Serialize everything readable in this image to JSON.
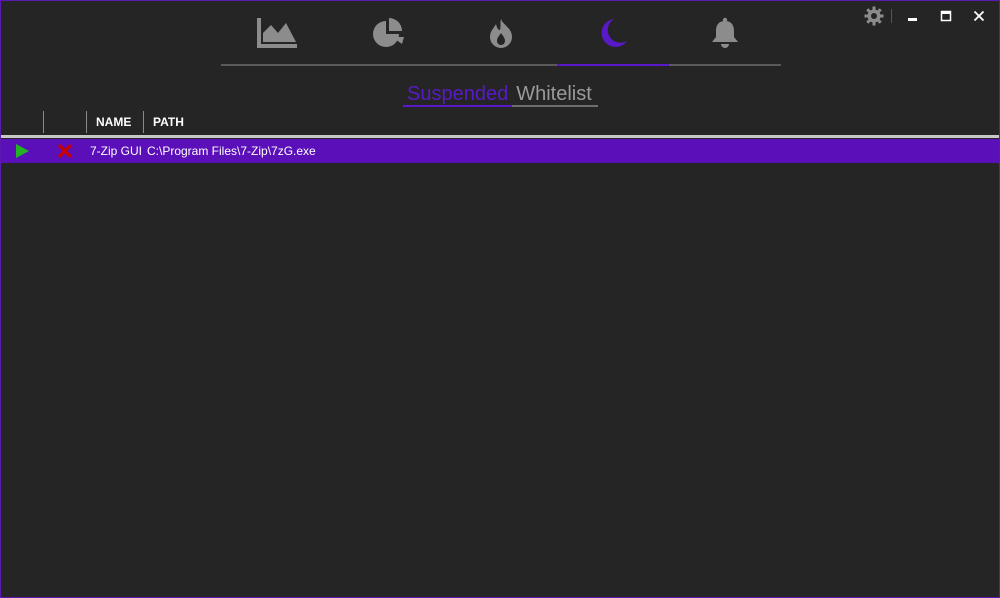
{
  "window": {
    "settings_icon": "gear-icon",
    "minimize_icon": "minimize-icon",
    "maximize_icon": "maximize-icon",
    "close_icon": "close-icon"
  },
  "nav": {
    "items": [
      {
        "icon": "area-chart-icon",
        "active": false
      },
      {
        "icon": "pie-chart-icon",
        "active": false
      },
      {
        "icon": "flame-icon",
        "active": false
      },
      {
        "icon": "moon-icon",
        "active": true
      },
      {
        "icon": "bell-icon",
        "active": false
      }
    ]
  },
  "subtabs": {
    "suspended": "Suspended",
    "whitelist": "Whitelist"
  },
  "table": {
    "columns": [
      "",
      "",
      "NAME",
      "PATH"
    ],
    "rows": [
      {
        "resume_icon": "play-icon",
        "remove_icon": "x-icon",
        "name": "7-Zip GUI",
        "path": "C:\\Program Files\\7-Zip\\7zG.exe"
      }
    ]
  },
  "colors": {
    "accent": "#5a19c8",
    "row_selected": "#5a0fb8",
    "background": "#252525",
    "icon_inactive": "#8c8c8c",
    "play_green": "#22b422",
    "remove_red": "#c80000"
  }
}
